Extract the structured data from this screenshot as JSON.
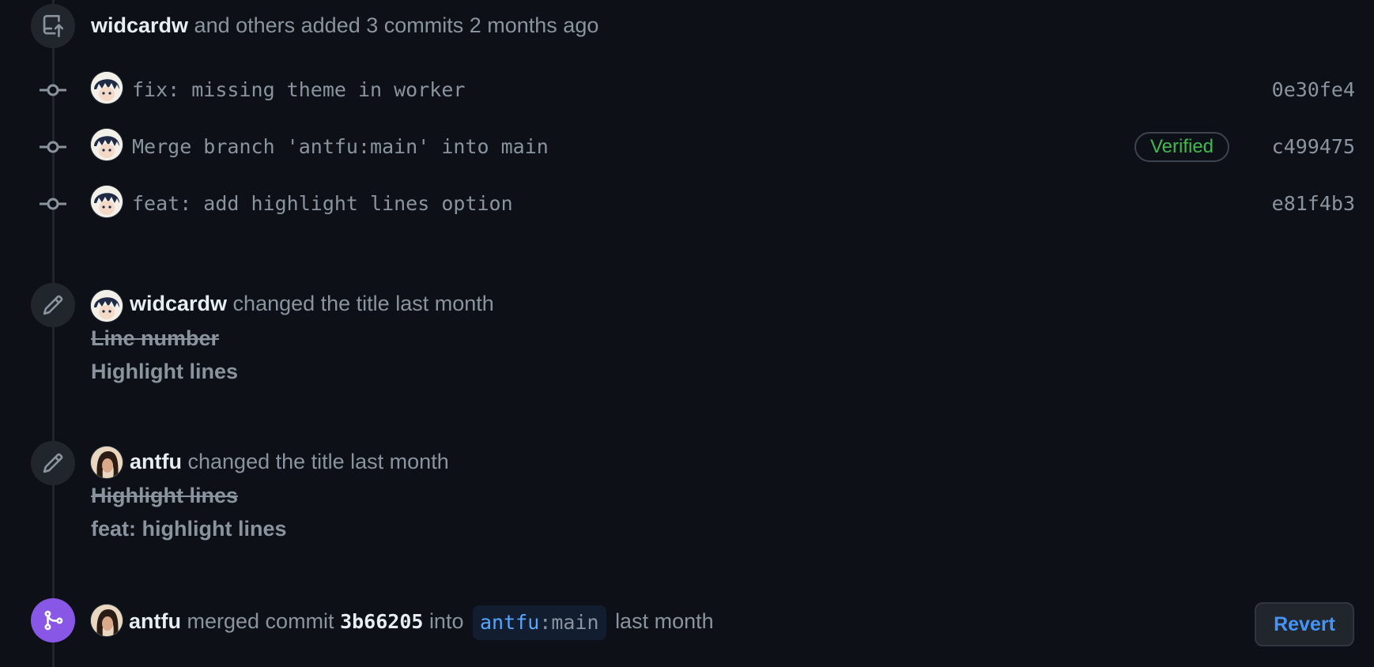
{
  "commits_event": {
    "author": "widcardw",
    "summary": "and others added 3 commits 2 months ago"
  },
  "commits": [
    {
      "message": "fix: missing theme in worker",
      "sha": "0e30fe4",
      "verified": ""
    },
    {
      "message": "Merge branch 'antfu:main' into main",
      "sha": "c499475",
      "verified": "Verified"
    },
    {
      "message": "feat: add highlight lines option",
      "sha": "e81f4b3",
      "verified": ""
    }
  ],
  "rename_events": [
    {
      "actor": "widcardw",
      "action": "changed the title last month",
      "old_title": "Line number",
      "new_title": "Highlight lines"
    },
    {
      "actor": "antfu",
      "action": "changed the title last month",
      "old_title": "Highlight lines",
      "new_title": "feat: highlight lines"
    }
  ],
  "merge_event": {
    "actor": "antfu",
    "action": "merged commit",
    "commit": "3b66205",
    "into": "into",
    "branch_owner": "antfu",
    "branch_sep": ":",
    "branch_name": "main",
    "time": "last month",
    "revert_label": "Revert"
  },
  "colors": {
    "background": "#0d1117",
    "verified": "#3fb950",
    "link": "#4493f8",
    "merged_badge": "#8957e5"
  },
  "icons": {
    "commits_badge": "repo-push-icon",
    "commit_node": "git-commit-icon",
    "rename_badge": "pencil-icon",
    "merge_badge": "git-merge-icon"
  }
}
